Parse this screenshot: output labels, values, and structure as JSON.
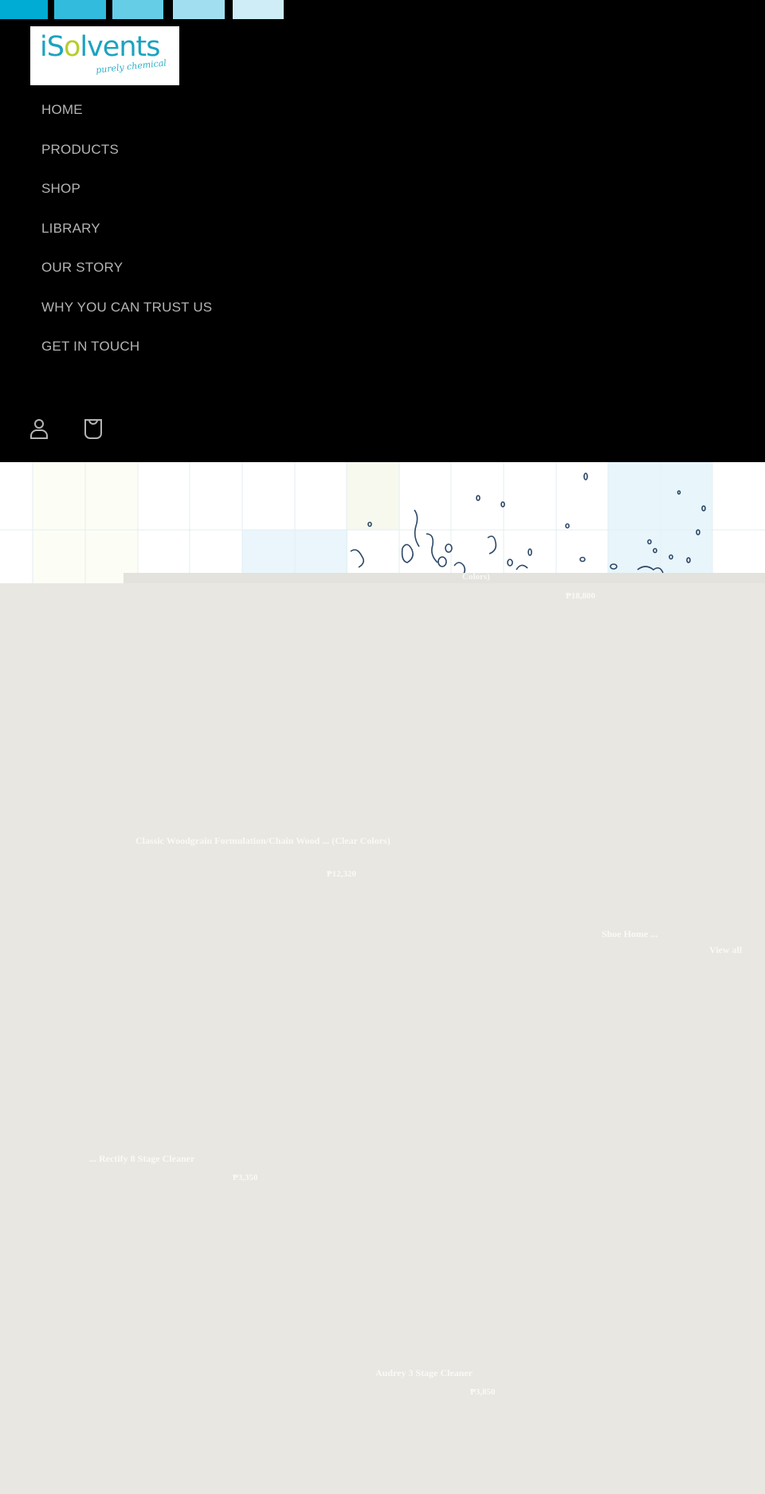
{
  "brand": {
    "name_prefix": "iS",
    "name_o": "o",
    "name_suffix": "lvents",
    "tagline": "purely chemical",
    "colors": {
      "bar_1": "#00acd3",
      "bar_2": "#32bbdc",
      "bar_3": "#66cde6",
      "bar_4": "#a1dff0",
      "bar_5": "#ceedf6",
      "logo_text": "#1ba3bf",
      "logo_accent": "#b8cc2e",
      "header_bg": "#000000",
      "panel_bg": "#e8e7e2"
    }
  },
  "nav": {
    "items": [
      {
        "label": "HOME"
      },
      {
        "label": "PRODUCTS"
      },
      {
        "label": "SHOP"
      },
      {
        "label": "LIBRARY"
      },
      {
        "label": "OUR STORY"
      },
      {
        "label": "WHY YOU CAN TRUST US"
      },
      {
        "label": "GET IN TOUCH"
      }
    ]
  },
  "header_icons": {
    "account": "account-icon",
    "cart": "cart-icon"
  },
  "products": [
    {
      "title_fragment": "Colors)",
      "price": "₱18,800"
    },
    {
      "title": "Classic Woodgrain Formulation/Chain Wood ... (Clear Colors)",
      "price": "₱12,320"
    },
    {
      "title": "Shoe Home ...",
      "link": "View all"
    },
    {
      "title": "... Rectify 8 Stage Cleaner",
      "price": "₱3,350"
    },
    {
      "title": "Audrey 3 Stage Cleaner",
      "price": "₱3,850"
    }
  ]
}
